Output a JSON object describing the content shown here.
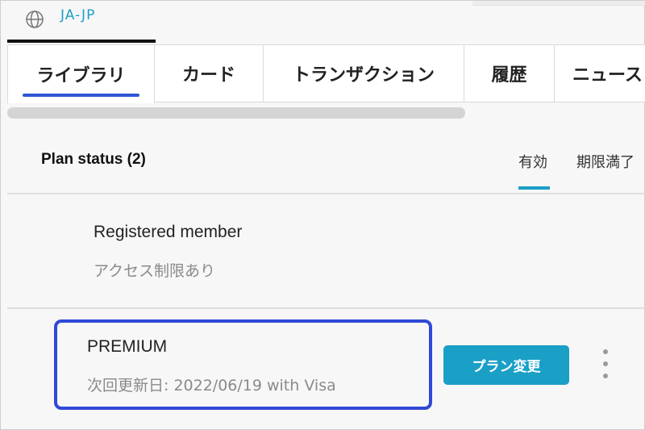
{
  "header": {
    "language_icon": "globe-icon",
    "language_label": "JA-JP"
  },
  "tabs": [
    {
      "label": "ライブラリ",
      "active": true
    },
    {
      "label": "カード",
      "active": false
    },
    {
      "label": "トランザクション",
      "active": false
    },
    {
      "label": "履歴",
      "active": false
    },
    {
      "label": "ニュース",
      "active": false
    }
  ],
  "plan_status": {
    "title": "Plan status (2)",
    "filters": {
      "active": "有効",
      "expired": "期限満了"
    }
  },
  "plans": [
    {
      "name": "Registered member",
      "detail": "アクセス制限あり"
    },
    {
      "name": "PREMIUM",
      "detail": "次回更新日: 2022/06/19 with Visa",
      "action_label": "プラン変更"
    }
  ],
  "colors": {
    "accent": "#1a9fc7",
    "highlight_border": "#3049d6",
    "tab_underline": "#2f55d4"
  }
}
